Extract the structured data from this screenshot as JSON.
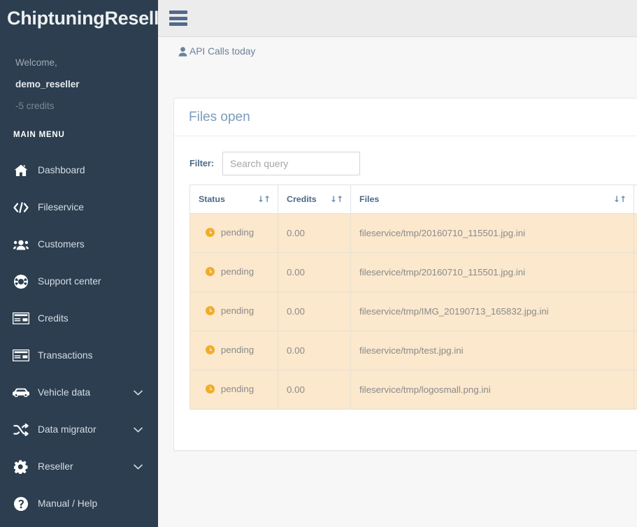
{
  "sidebar": {
    "brand": "ChiptuningReseller",
    "welcome": "Welcome,",
    "username": "demo_reseller",
    "credits": "-5 credits",
    "menu_heading": "MAIN MENU",
    "items": [
      {
        "label": "Dashboard",
        "icon": "home-icon",
        "caret": false
      },
      {
        "label": "Fileservice",
        "icon": "code-icon",
        "caret": false
      },
      {
        "label": "Customers",
        "icon": "users-icon",
        "caret": false
      },
      {
        "label": "Support center",
        "icon": "lifebuoy-icon",
        "caret": false
      },
      {
        "label": "Credits",
        "icon": "credit-card-icon",
        "caret": false
      },
      {
        "label": "Transactions",
        "icon": "credit-card-icon",
        "caret": false
      },
      {
        "label": "Vehicle data",
        "icon": "car-icon",
        "caret": true
      },
      {
        "label": "Data migrator",
        "icon": "shuffle-icon",
        "caret": true
      },
      {
        "label": "Reseller",
        "icon": "gear-icon",
        "caret": true
      },
      {
        "label": "Manual / Help",
        "icon": "question-circle-icon",
        "caret": false
      }
    ]
  },
  "topbar": {
    "menu_toggle": "hamburger-icon"
  },
  "content": {
    "api_calls_label": "API Calls today",
    "api_calls_icon": "person-icon"
  },
  "panel": {
    "title": "Files open",
    "filter_label": "Filter:",
    "search_placeholder": "Search query",
    "search_value": ""
  },
  "table": {
    "columns": [
      {
        "label": "Status",
        "sortable": true
      },
      {
        "label": "Credits",
        "sortable": true
      },
      {
        "label": "Files",
        "sortable": true
      },
      {
        "label": "",
        "sortable": false
      }
    ],
    "sort_glyph": "↓↑",
    "rows": [
      {
        "status": "pending",
        "credits": "0.00",
        "file": "fileservice/tmp/20160710_115501.jpg.ini"
      },
      {
        "status": "pending",
        "credits": "0.00",
        "file": "fileservice/tmp/20160710_115501.jpg.ini"
      },
      {
        "status": "pending",
        "credits": "0.00",
        "file": "fileservice/tmp/IMG_20190713_165832.jpg.ini"
      },
      {
        "status": "pending",
        "credits": "0.00",
        "file": "fileservice/tmp/test.jpg.ini"
      },
      {
        "status": "pending",
        "credits": "0.00",
        "file": "fileservice/tmp/logosmall.png.ini"
      }
    ]
  },
  "colors": {
    "sidebar_bg": "#2c3e50",
    "accent_blue": "#7b9bbb",
    "row_bg": "#fbe8cd",
    "status_amber": "#f0ad28",
    "topbar_bg": "#ececec"
  }
}
